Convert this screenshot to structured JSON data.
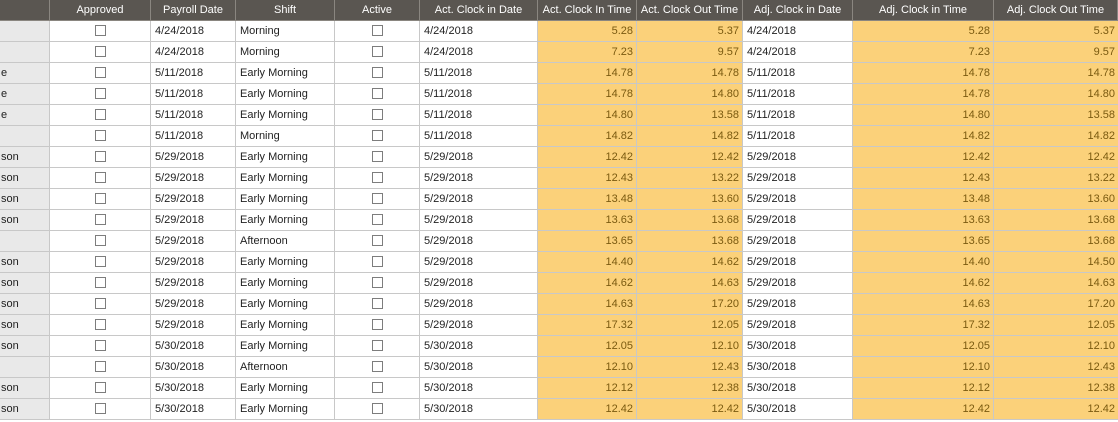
{
  "columns": {
    "c0": "",
    "approved": "Approved",
    "payroll_date": "Payroll Date",
    "shift": "Shift",
    "active": "Active",
    "act_clock_in_date": "Act. Clock in Date",
    "act_clock_in_time": "Act. Clock In Time",
    "act_clock_out_time": "Act. Clock Out Time",
    "adj_clock_in_date": "Adj. Clock in Date",
    "adj_clock_in_time": "Adj. Clock in Time",
    "adj_clock_out_time": "Adj. Clock Out Time"
  },
  "colors": {
    "header_bg": "#5a5651",
    "highlight": "#fbd17a",
    "first_col_bg": "#e9e9e9"
  },
  "rows": [
    {
      "c0": "",
      "approved": false,
      "payroll": "4/24/2018",
      "shift": "Morning",
      "active": false,
      "act_date": "4/24/2018",
      "act_in": "5.28",
      "act_out": "5.37",
      "adj_date": "4/24/2018",
      "adj_in": "5.28",
      "adj_out": "5.37"
    },
    {
      "c0": "",
      "approved": false,
      "payroll": "4/24/2018",
      "shift": "Morning",
      "active": false,
      "act_date": "4/24/2018",
      "act_in": "7.23",
      "act_out": "9.57",
      "adj_date": "4/24/2018",
      "adj_in": "7.23",
      "adj_out": "9.57"
    },
    {
      "c0": "e",
      "approved": false,
      "payroll": "5/11/2018",
      "shift": "Early Morning",
      "active": false,
      "act_date": "5/11/2018",
      "act_in": "14.78",
      "act_out": "14.78",
      "adj_date": "5/11/2018",
      "adj_in": "14.78",
      "adj_out": "14.78"
    },
    {
      "c0": "e",
      "approved": false,
      "payroll": "5/11/2018",
      "shift": "Early Morning",
      "active": false,
      "act_date": "5/11/2018",
      "act_in": "14.78",
      "act_out": "14.80",
      "adj_date": "5/11/2018",
      "adj_in": "14.78",
      "adj_out": "14.80"
    },
    {
      "c0": "e",
      "approved": false,
      "payroll": "5/11/2018",
      "shift": "Early Morning",
      "active": false,
      "act_date": "5/11/2018",
      "act_in": "14.80",
      "act_out": "13.58",
      "adj_date": "5/11/2018",
      "adj_in": "14.80",
      "adj_out": "13.58"
    },
    {
      "c0": "",
      "approved": false,
      "payroll": "5/11/2018",
      "shift": "Morning",
      "active": false,
      "act_date": "5/11/2018",
      "act_in": "14.82",
      "act_out": "14.82",
      "adj_date": "5/11/2018",
      "adj_in": "14.82",
      "adj_out": "14.82"
    },
    {
      "c0": "son",
      "approved": false,
      "payroll": "5/29/2018",
      "shift": "Early Morning",
      "active": false,
      "act_date": "5/29/2018",
      "act_in": "12.42",
      "act_out": "12.42",
      "adj_date": "5/29/2018",
      "adj_in": "12.42",
      "adj_out": "12.42"
    },
    {
      "c0": "son",
      "approved": false,
      "payroll": "5/29/2018",
      "shift": "Early Morning",
      "active": false,
      "act_date": "5/29/2018",
      "act_in": "12.43",
      "act_out": "13.22",
      "adj_date": "5/29/2018",
      "adj_in": "12.43",
      "adj_out": "13.22"
    },
    {
      "c0": "son",
      "approved": false,
      "payroll": "5/29/2018",
      "shift": "Early Morning",
      "active": false,
      "act_date": "5/29/2018",
      "act_in": "13.48",
      "act_out": "13.60",
      "adj_date": "5/29/2018",
      "adj_in": "13.48",
      "adj_out": "13.60"
    },
    {
      "c0": "son",
      "approved": false,
      "payroll": "5/29/2018",
      "shift": "Early Morning",
      "active": false,
      "act_date": "5/29/2018",
      "act_in": "13.63",
      "act_out": "13.68",
      "adj_date": "5/29/2018",
      "adj_in": "13.63",
      "adj_out": "13.68"
    },
    {
      "c0": "",
      "approved": false,
      "payroll": "5/29/2018",
      "shift": "Afternoon",
      "active": false,
      "act_date": "5/29/2018",
      "act_in": "13.65",
      "act_out": "13.68",
      "adj_date": "5/29/2018",
      "adj_in": "13.65",
      "adj_out": "13.68"
    },
    {
      "c0": "son",
      "approved": false,
      "payroll": "5/29/2018",
      "shift": "Early Morning",
      "active": false,
      "act_date": "5/29/2018",
      "act_in": "14.40",
      "act_out": "14.62",
      "adj_date": "5/29/2018",
      "adj_in": "14.40",
      "adj_out": "14.50"
    },
    {
      "c0": "son",
      "approved": false,
      "payroll": "5/29/2018",
      "shift": "Early Morning",
      "active": false,
      "act_date": "5/29/2018",
      "act_in": "14.62",
      "act_out": "14.63",
      "adj_date": "5/29/2018",
      "adj_in": "14.62",
      "adj_out": "14.63"
    },
    {
      "c0": "son",
      "approved": false,
      "payroll": "5/29/2018",
      "shift": "Early Morning",
      "active": false,
      "act_date": "5/29/2018",
      "act_in": "14.63",
      "act_out": "17.20",
      "adj_date": "5/29/2018",
      "adj_in": "14.63",
      "adj_out": "17.20"
    },
    {
      "c0": "son",
      "approved": false,
      "payroll": "5/29/2018",
      "shift": "Early Morning",
      "active": false,
      "act_date": "5/29/2018",
      "act_in": "17.32",
      "act_out": "12.05",
      "adj_date": "5/29/2018",
      "adj_in": "17.32",
      "adj_out": "12.05"
    },
    {
      "c0": "son",
      "approved": false,
      "payroll": "5/30/2018",
      "shift": "Early Morning",
      "active": false,
      "act_date": "5/30/2018",
      "act_in": "12.05",
      "act_out": "12.10",
      "adj_date": "5/30/2018",
      "adj_in": "12.05",
      "adj_out": "12.10"
    },
    {
      "c0": "",
      "approved": false,
      "payroll": "5/30/2018",
      "shift": "Afternoon",
      "active": false,
      "act_date": "5/30/2018",
      "act_in": "12.10",
      "act_out": "12.43",
      "adj_date": "5/30/2018",
      "adj_in": "12.10",
      "adj_out": "12.43"
    },
    {
      "c0": "son",
      "approved": false,
      "payroll": "5/30/2018",
      "shift": "Early Morning",
      "active": false,
      "act_date": "5/30/2018",
      "act_in": "12.12",
      "act_out": "12.38",
      "adj_date": "5/30/2018",
      "adj_in": "12.12",
      "adj_out": "12.38"
    },
    {
      "c0": "son",
      "approved": false,
      "payroll": "5/30/2018",
      "shift": "Early Morning",
      "active": false,
      "act_date": "5/30/2018",
      "act_in": "12.42",
      "act_out": "12.42",
      "adj_date": "5/30/2018",
      "adj_in": "12.42",
      "adj_out": "12.42"
    }
  ]
}
